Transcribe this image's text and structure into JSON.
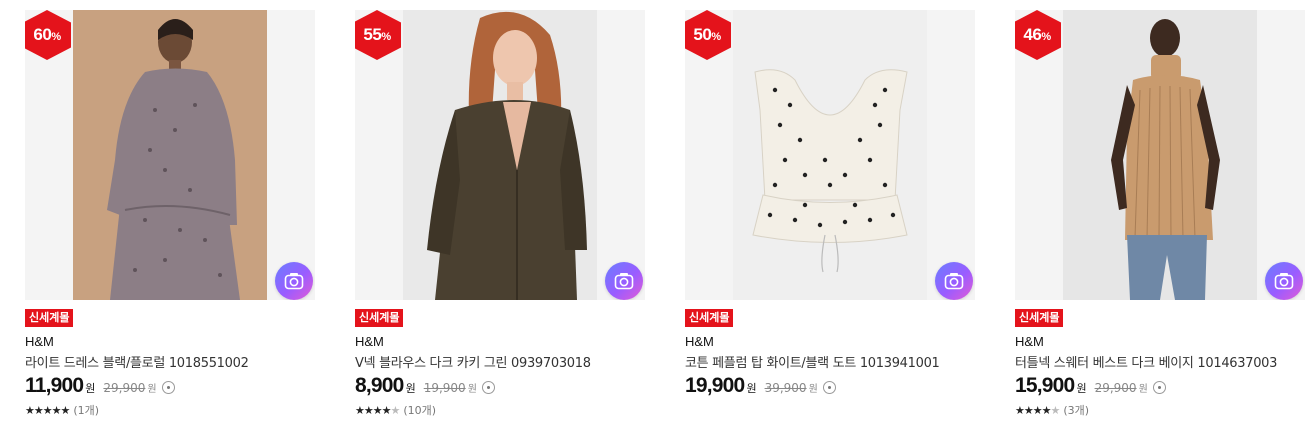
{
  "products": [
    {
      "discount": "60",
      "discount_unit": "%",
      "tag": "신세계몰",
      "brand": "H&M",
      "name": "라이트 드레스 블랙/플로럴 1018551002",
      "price": "11,900",
      "price_unit": "원",
      "original_price": "29,900",
      "original_unit": "원",
      "stars": "★★★★★",
      "stars_empty": "",
      "reviews": "(1개)",
      "rating": 5,
      "photo_bg": "#c8a180"
    },
    {
      "discount": "55",
      "discount_unit": "%",
      "tag": "신세계몰",
      "brand": "H&M",
      "name": "V넥 블라우스 다크 카키 그린 0939703018",
      "price": "8,900",
      "price_unit": "원",
      "original_price": "19,900",
      "original_unit": "원",
      "stars": "★★★★",
      "stars_empty": "★",
      "reviews": "(10개)",
      "rating": 4.5,
      "photo_bg": "#e9e9e9"
    },
    {
      "discount": "50",
      "discount_unit": "%",
      "tag": "신세계몰",
      "brand": "H&M",
      "name": "코튼 페플럼 탑 화이트/블랙 도트 1013941001",
      "price": "19,900",
      "price_unit": "원",
      "original_price": "39,900",
      "original_unit": "원",
      "stars": "",
      "stars_empty": "",
      "reviews": "",
      "rating": null,
      "photo_bg": "#efefef"
    },
    {
      "discount": "46",
      "discount_unit": "%",
      "tag": "신세계몰",
      "brand": "H&M",
      "name": "터틀넥 스웨터 베스트 다크 베이지 1014637003",
      "price": "15,900",
      "price_unit": "원",
      "original_price": "29,900",
      "original_unit": "원",
      "stars": "★★★★",
      "stars_empty": "★",
      "reviews": "(3개)",
      "rating": 4.5,
      "photo_bg": "#e6e6e6"
    }
  ],
  "colors": {
    "accent_red": "#e4131b",
    "camera_gradient_start": "#6a7dff",
    "camera_gradient_end": "#e35bd6"
  },
  "icons": {
    "camera": "camera-search-icon",
    "info": "info-circle-icon",
    "star": "star-icon"
  }
}
